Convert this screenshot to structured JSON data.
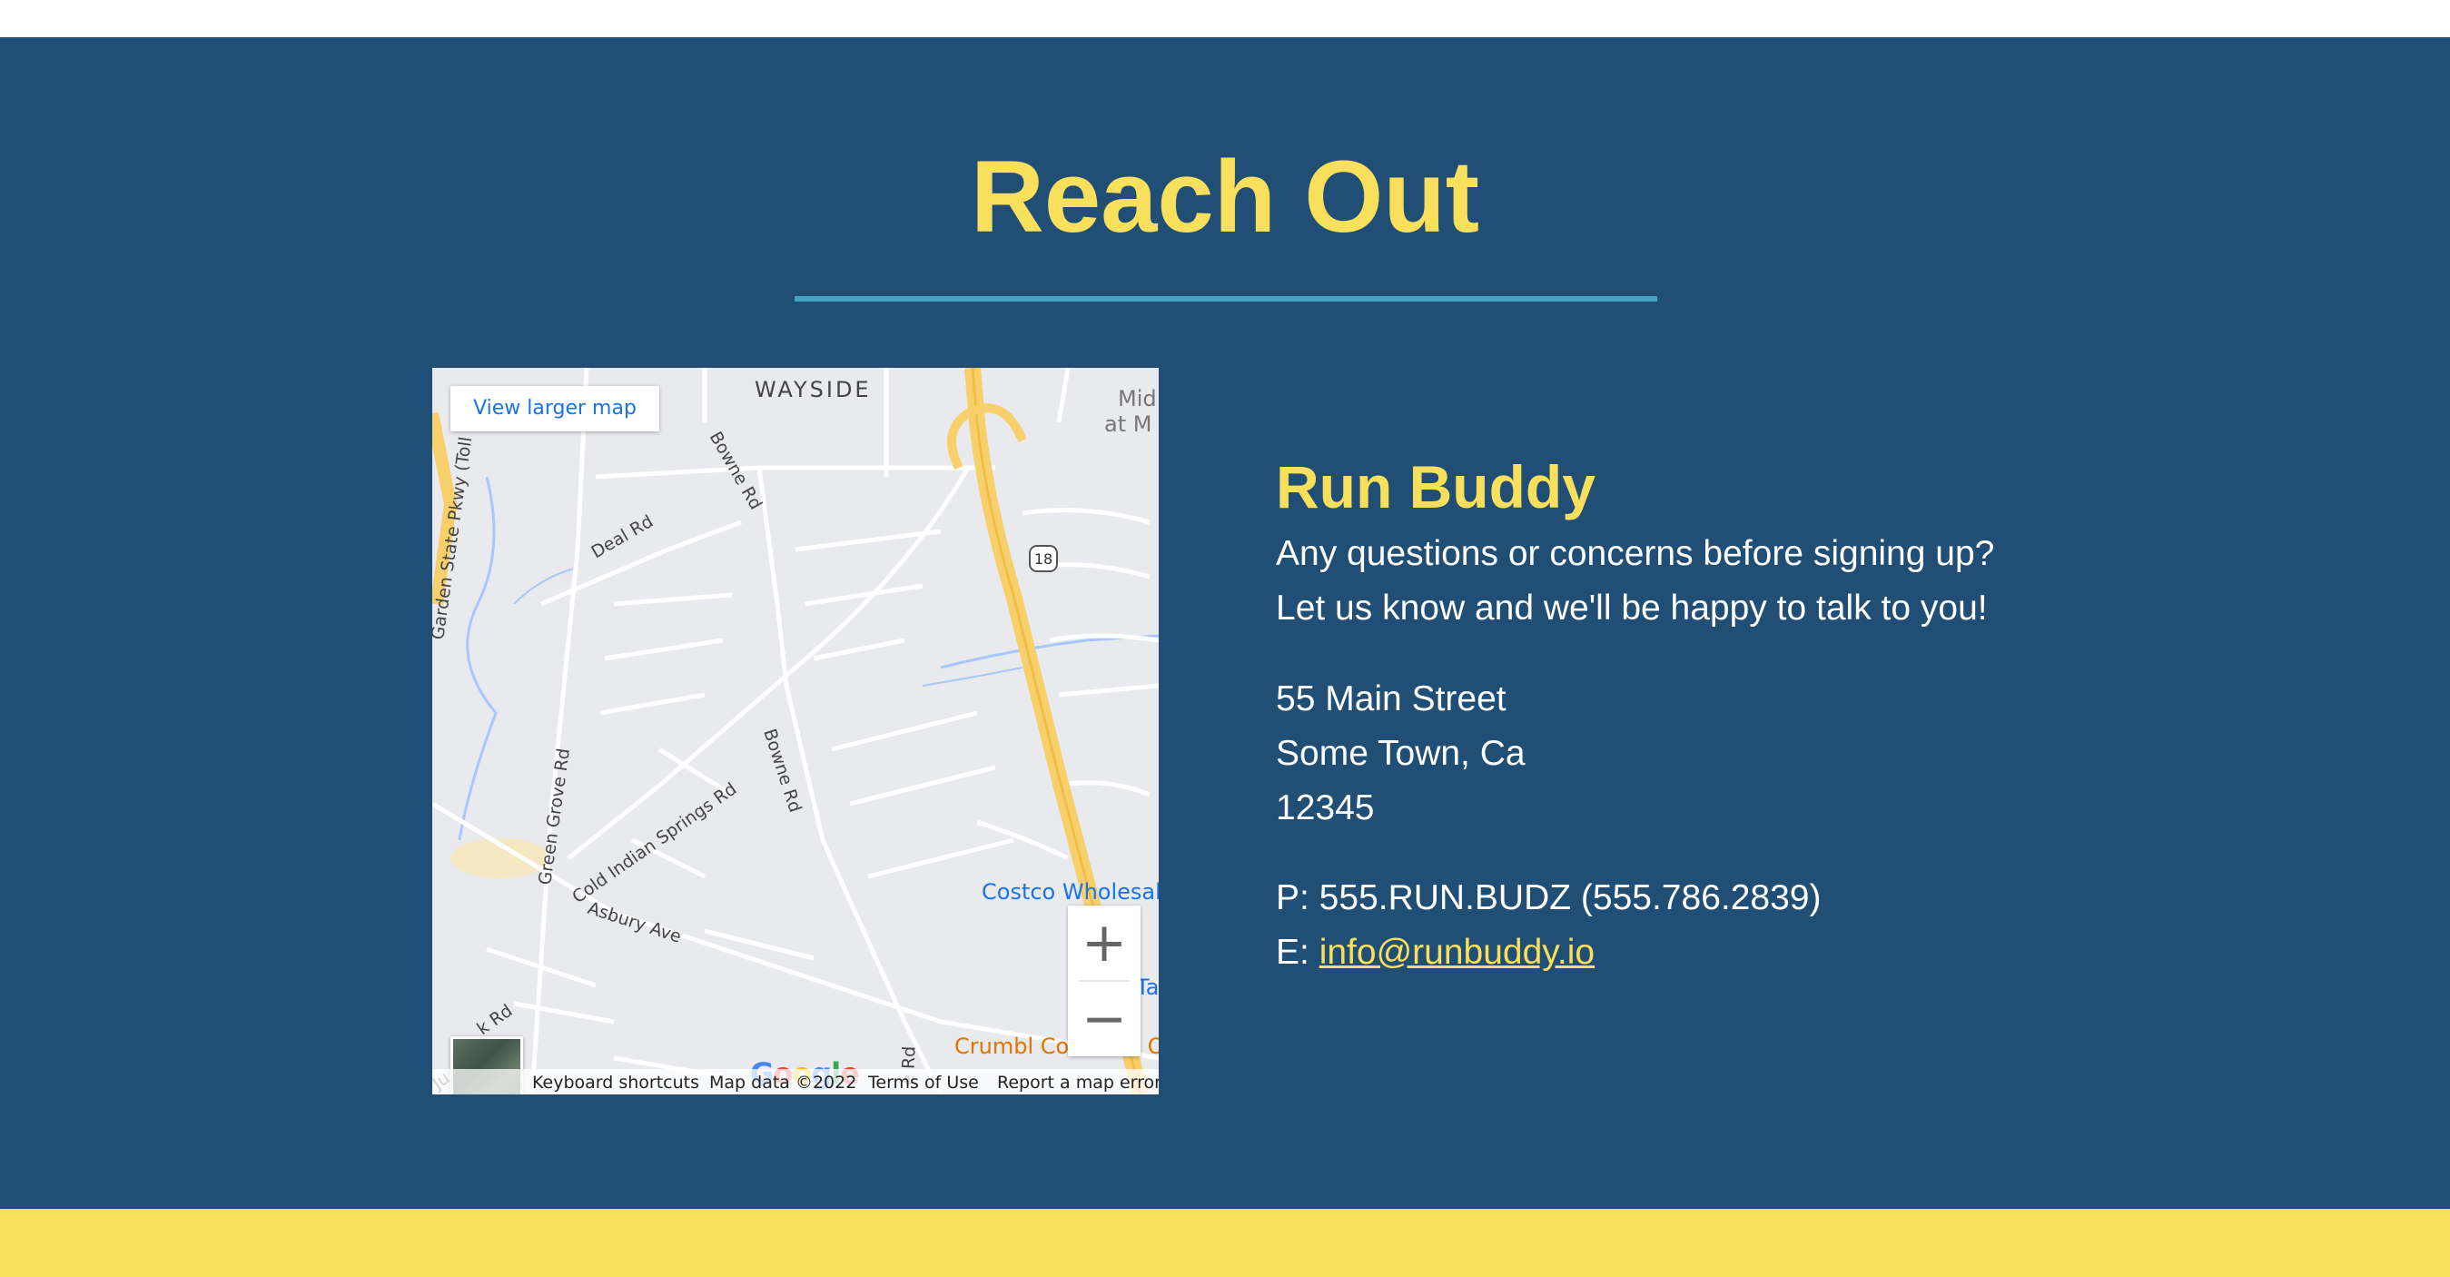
{
  "section": {
    "title": "Reach Out"
  },
  "map": {
    "view_larger_label": "View larger map",
    "zoom_in_label": "+",
    "zoom_out_label": "−",
    "google_logo_letters": [
      "G",
      "o",
      "o",
      "g",
      "l",
      "e"
    ],
    "attribution": {
      "keyboard_shortcuts": "Keyboard shortcuts",
      "map_data": "Map data ©2022",
      "terms": "Terms of Use",
      "report": "Report a map error"
    },
    "labels": {
      "wayside": "WAYSIDE",
      "bowne_rd_top": "Bowne Rd",
      "deal_rd": "Deal Rd",
      "bowne_rd_mid": "Bowne Rd",
      "green_grove_rd": "Green Grove Rd",
      "cold_indian_springs_rd": "Cold Indian Springs Rd",
      "asbury_ave": "Asbury Ave",
      "parkway": "Garden State Pkwy (Toll road)",
      "costco": "Costco Wholesale",
      "crumbl": "Crumbl Cookies - O",
      "route_shield": "18",
      "mid_top": "Mid",
      "mid_bottom": "at M",
      "partial_rd": "k Rd",
      "partial_ju": "Ju",
      "partial_ta": "Ta",
      "e_rd": "e Rd"
    }
  },
  "contact": {
    "name": "Run Buddy",
    "message_line1": "Any questions or concerns before signing up?",
    "message_line2": "Let us know and we'll be happy to talk to you!",
    "address_line1": "55 Main Street",
    "address_line2": "Some Town, Ca",
    "address_line3": "12345",
    "phone": "P: 555.RUN.BUDZ (555.786.2839)",
    "email_prefix": "E: ",
    "email": "info@runbuddy.io"
  },
  "colors": {
    "section_bg": "#204e74",
    "accent_yellow": "#f8df5c",
    "rule_teal": "#42a5c4",
    "white": "#ffffff"
  }
}
